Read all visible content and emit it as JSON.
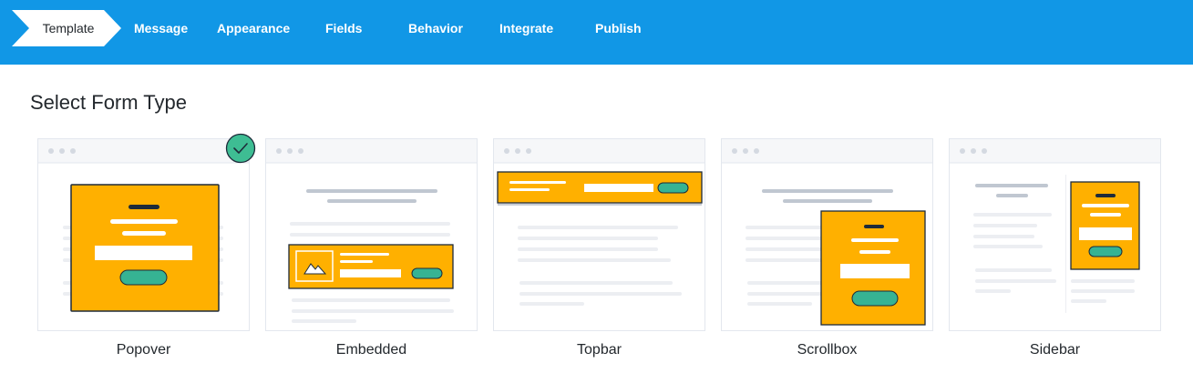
{
  "nav": {
    "steps": [
      {
        "label": "Template",
        "active": true
      },
      {
        "label": "Message"
      },
      {
        "label": "Appearance"
      },
      {
        "label": "Fields"
      },
      {
        "label": "Behavior"
      },
      {
        "label": "Integrate"
      },
      {
        "label": "Publish"
      }
    ]
  },
  "main": {
    "title": "Select Form Type",
    "selected": "Popover",
    "form_types": [
      {
        "label": "Popover",
        "icon": "popover-preview-icon"
      },
      {
        "label": "Embedded",
        "icon": "embedded-preview-icon"
      },
      {
        "label": "Topbar",
        "icon": "topbar-preview-icon"
      },
      {
        "label": "Scrollbox",
        "icon": "scrollbox-preview-icon"
      },
      {
        "label": "Sidebar",
        "icon": "sidebar-preview-icon"
      }
    ]
  },
  "colors": {
    "nav_bg": "#1197e6",
    "form_orange": "#ffb000",
    "button_green": "#36b393",
    "check_green": "#3ebd93"
  }
}
